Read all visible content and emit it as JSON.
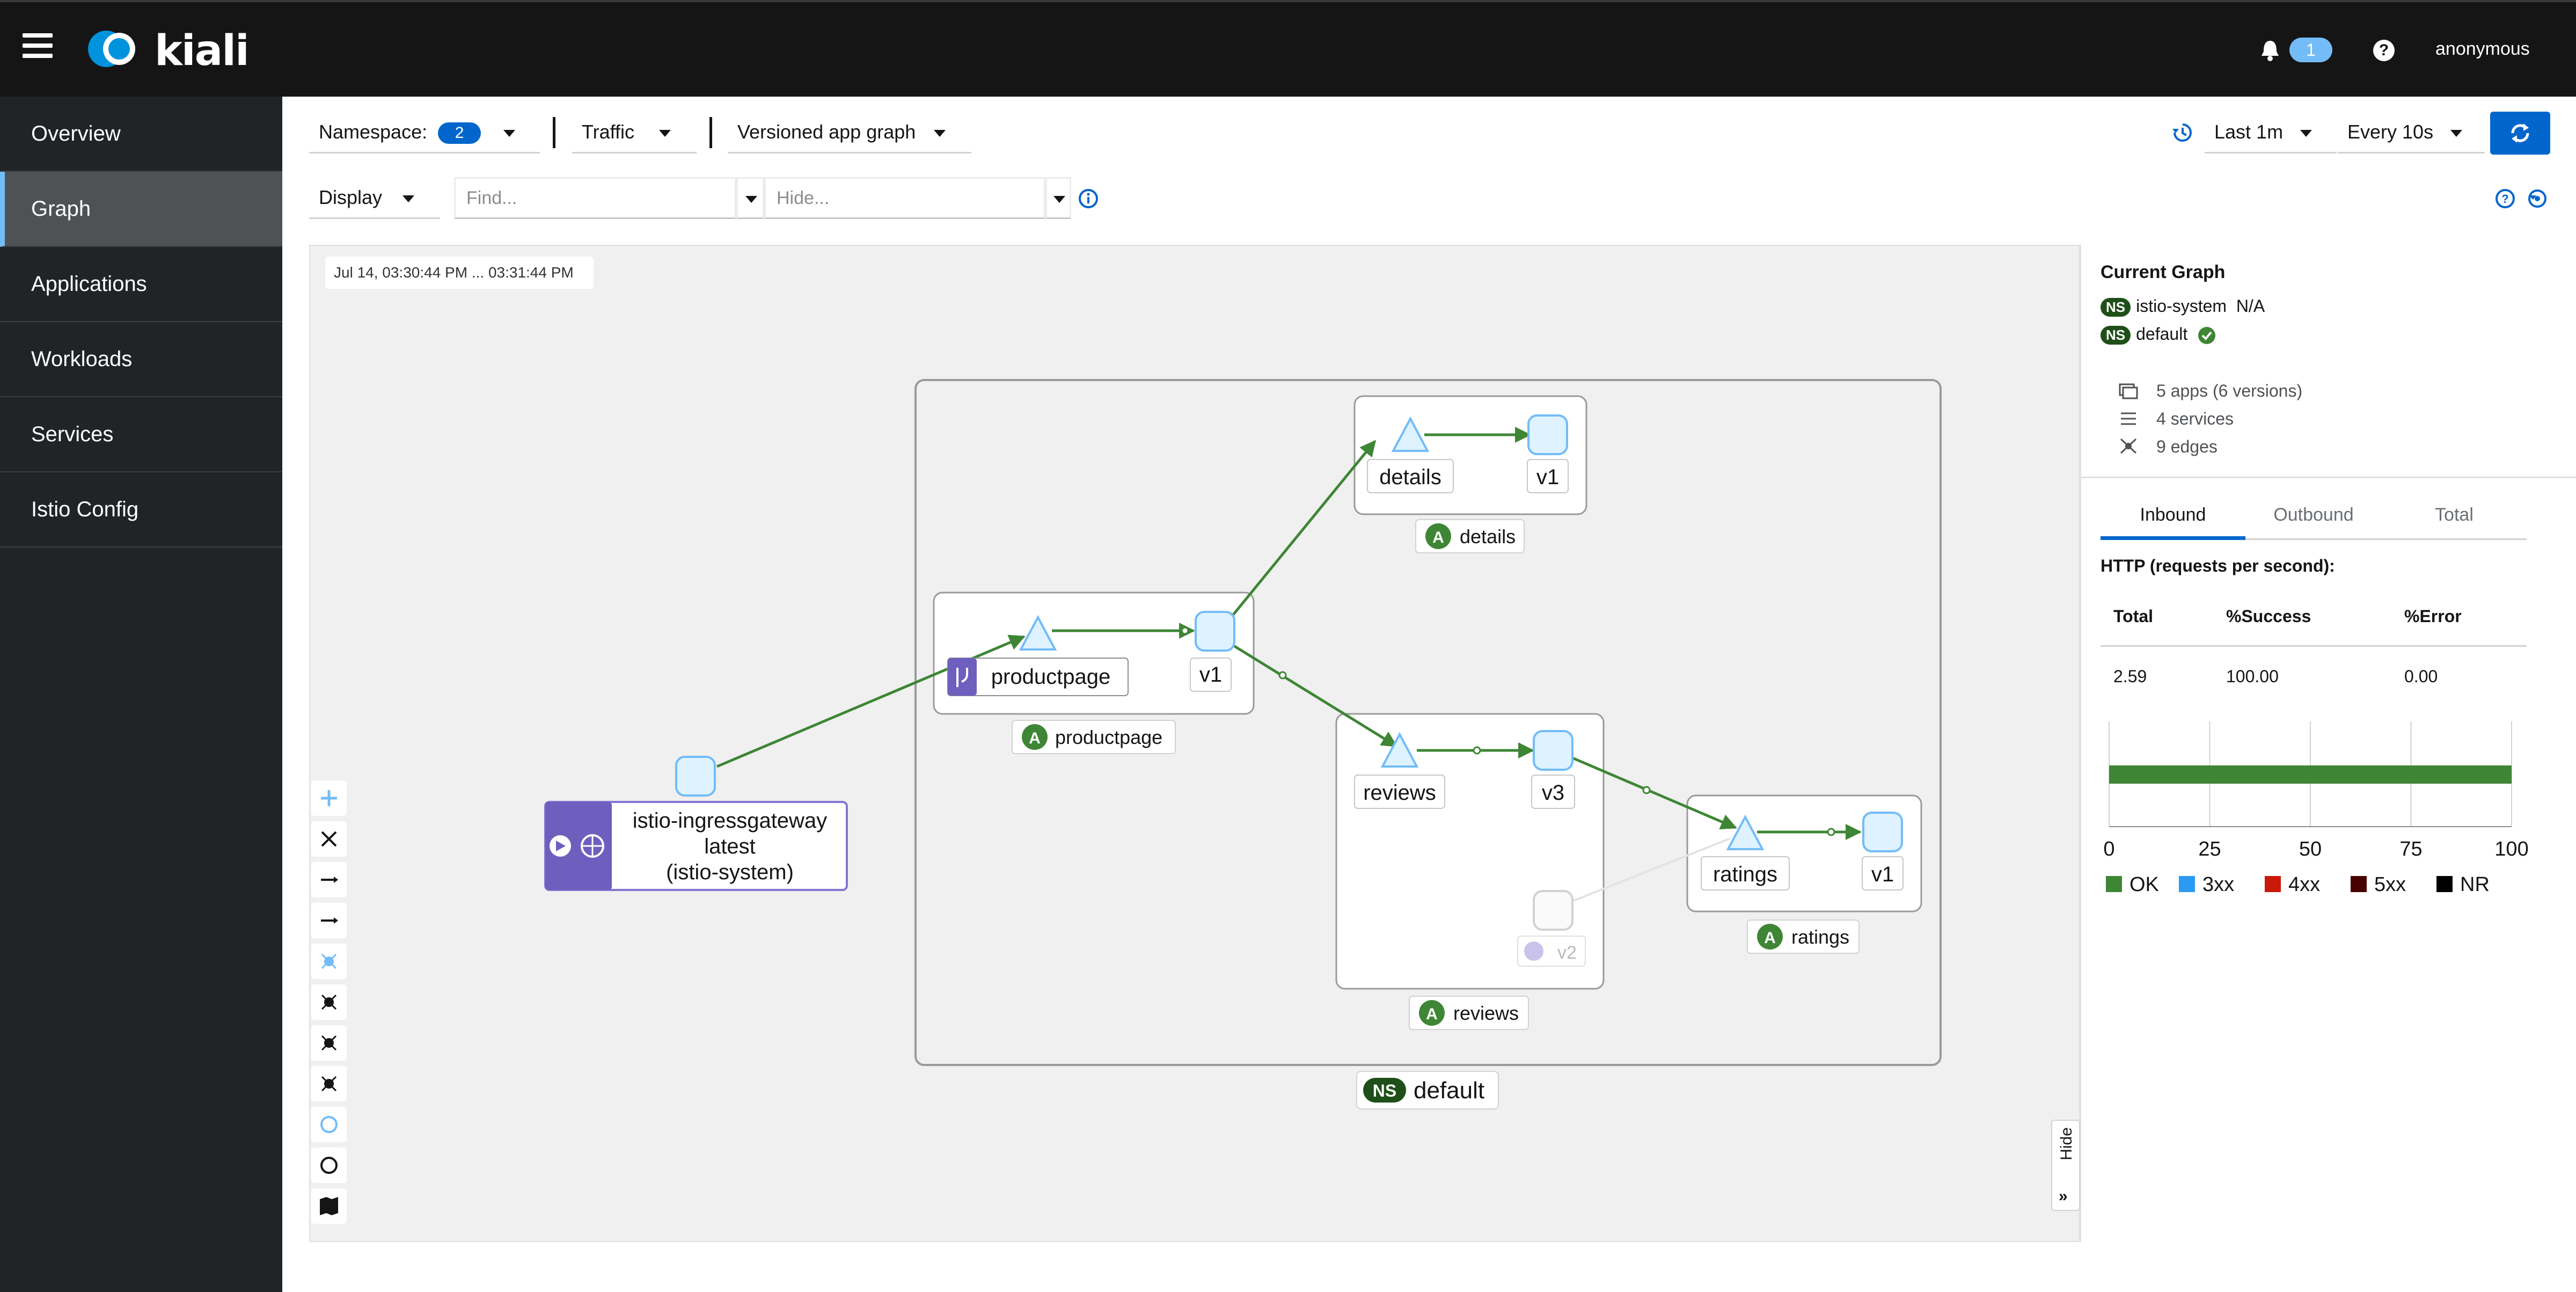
{
  "header": {
    "brand": "kiali",
    "notification_count": "1",
    "help": "?",
    "user": "anonymous"
  },
  "sidebar": {
    "items": [
      {
        "label": "Overview"
      },
      {
        "label": "Graph",
        "active": true
      },
      {
        "label": "Applications"
      },
      {
        "label": "Workloads"
      },
      {
        "label": "Services"
      },
      {
        "label": "Istio Config"
      }
    ]
  },
  "toolbar": {
    "namespace_label": "Namespace:",
    "namespace_count": "2",
    "traffic_label": "Traffic",
    "graph_type": "Versioned app graph",
    "time_range": "Last 1m",
    "refresh_interval": "Every 10s",
    "display_label": "Display",
    "find_placeholder": "Find...",
    "hide_placeholder": "Hide..."
  },
  "graph": {
    "timestamp": "Jul 14, 03:30:44 PM ... 03:31:44 PM",
    "namespace_box": {
      "badge": "NS",
      "label": "default"
    },
    "ingress": {
      "line1": "istio-ingressgateway",
      "line2": "latest",
      "line3": "(istio-system)"
    },
    "app_badge": "A",
    "boxes": {
      "details": {
        "service": "details",
        "version": "v1",
        "app": "details"
      },
      "productpage": {
        "service": "productpage",
        "version": "v1",
        "app": "productpage"
      },
      "reviews": {
        "service": "reviews",
        "version": "v3",
        "version2": "v2",
        "app": "reviews"
      },
      "ratings": {
        "service": "ratings",
        "version": "v1",
        "app": "ratings"
      }
    },
    "hide_label": "Hide",
    "colors": {
      "edge": "#3e8635",
      "node_fill": "#def3ff",
      "node_stroke": "#73bcf7",
      "ingress": "#6e5fbe",
      "ns_badge": "#1e4f18"
    }
  },
  "panel": {
    "title": "Current Graph",
    "namespaces": [
      {
        "badge": "NS",
        "name": "istio-system",
        "status": "N/A"
      },
      {
        "badge": "NS",
        "name": "default",
        "status_icon": "check-circle-icon"
      }
    ],
    "stats": {
      "apps": "5 apps (6 versions)",
      "services": "4 services",
      "edges": "9 edges"
    },
    "tabs": [
      "Inbound",
      "Outbound",
      "Total"
    ],
    "active_tab": "Inbound",
    "http_title": "HTTP (requests per second):",
    "table": {
      "headers": [
        "Total",
        "%Success",
        "%Error"
      ],
      "row": [
        "2.59",
        "100.00",
        "0.00"
      ]
    }
  },
  "chart_data": {
    "type": "bar",
    "categories": [
      ""
    ],
    "series": [
      {
        "name": "OK",
        "values": [
          100
        ],
        "color": "#3e8635"
      },
      {
        "name": "3xx",
        "values": [
          0
        ],
        "color": "#2b9af3"
      },
      {
        "name": "4xx",
        "values": [
          0
        ],
        "color": "#c9190b"
      },
      {
        "name": "5xx",
        "values": [
          0
        ],
        "color": "#470000"
      },
      {
        "name": "NR",
        "values": [
          0
        ],
        "color": "#000000"
      }
    ],
    "x_ticks": [
      "0",
      "25",
      "50",
      "75",
      "100"
    ],
    "xlim": [
      0,
      100
    ],
    "orientation": "horizontal",
    "stacked": true,
    "grid": true,
    "legend": "bottom"
  }
}
